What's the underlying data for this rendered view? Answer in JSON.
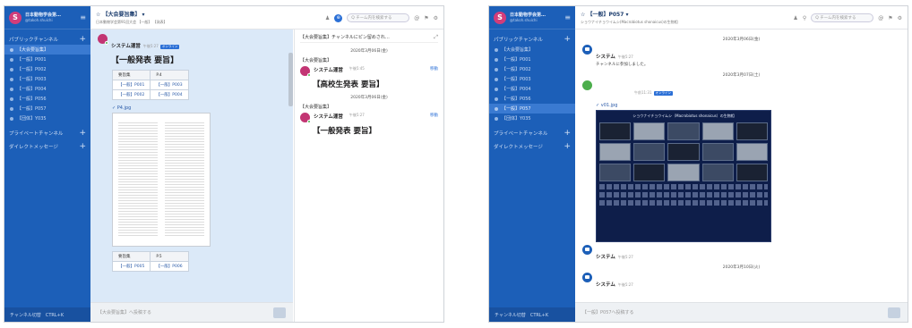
{
  "shot1": {
    "sidebar": {
      "team_name": "日本動物学会第…",
      "team_user": "@takoh.shuichi",
      "public_header": "パブリックチャンネル",
      "channels": [
        "【大会要旨集】",
        "【一般】P001",
        "【一般】P002",
        "【一般】P003",
        "【一般】P004",
        "【一般】P056",
        "【一般】P057",
        "【団体】Y035"
      ],
      "active_index": 0,
      "private_header": "プライベートチャンネル",
      "direct_header": "ダイレクトメッセージ",
      "footer": "チャンネル切替　CTRL+K"
    },
    "header": {
      "title": "☆ 【大会要旨集】 ▾",
      "subtitle": "日本動物学会第91回大会 【一般】 【発表】",
      "search_placeholder": "Q チーム内を検索する"
    },
    "timeline": {
      "sender": "システム運営",
      "time": "午後5:27",
      "badge": "オンライン",
      "title": "【一般発表 要旨】",
      "table": {
        "headers": [
          "要旨集",
          "P.4"
        ],
        "rows": [
          [
            "【一般】P001",
            "【一般】P003"
          ],
          [
            "【一般】P002",
            "【一般】P004"
          ]
        ]
      },
      "file": "P4.jpg",
      "table2": {
        "headers": [
          "要旨集",
          "P.5"
        ],
        "rows": [
          [
            "【一般】P005",
            "【一般】P006"
          ]
        ]
      },
      "composer_placeholder": "【大会要旨集】へ投稿する"
    },
    "rpanel": {
      "header": "【大会要旨集】チャンネルにピン留めされ…",
      "entries": [
        {
          "date": "2020年3月06日(金)",
          "channel": "【大会要旨集】",
          "sender": "システム運営",
          "time": "午後5:45",
          "move": "移動",
          "title": "【高校生発表 要旨】"
        },
        {
          "date": "2020年3月06日(金)",
          "channel": "【大会要旨集】",
          "sender": "システム運営",
          "time": "午後5:27",
          "move": "移動",
          "title": "【一般発表 要旨】"
        }
      ]
    }
  },
  "shot2": {
    "sidebar": {
      "team_name": "日本動物学会第…",
      "team_user": "@takoh.shuichi",
      "public_header": "パブリックチャンネル",
      "channels": [
        "【大会要旨集】",
        "【一般】P001",
        "【一般】P002",
        "【一般】P003",
        "【一般】P004",
        "【一般】P056",
        "【一般】P057",
        "【団体】Y035"
      ],
      "active_index": 6,
      "private_header": "プライベートチャンネル",
      "direct_header": "ダイレクトメッセージ",
      "footer": "チャンネル切替　CTRL+K"
    },
    "header": {
      "title": "☆ 【一般】P057 ▾",
      "subtitle": "ショウナイチョウイムシ(Macrobiotus shonaicus)の生物相",
      "search_placeholder": "Q チーム内を検索する"
    },
    "timeline": {
      "date1": "2020年3月06日(金)",
      "system1": "システム",
      "time1": "午後5:27",
      "joined": "チャンネルに参加しました。",
      "date2": "2020年3月07日(土)",
      "time2": "午前11:31",
      "badge": "オンライン",
      "file": "v01.jpg",
      "poster_title": "ショウナイチョウイムシ（Macrobiotus shonaicus）の生物相",
      "system2": "システム",
      "time3": "午後5:27",
      "date3": "2020年3月10日(火)",
      "system3": "システム",
      "time4": "午後5:27",
      "composer_placeholder": "【一般】P057へ投稿する"
    }
  }
}
